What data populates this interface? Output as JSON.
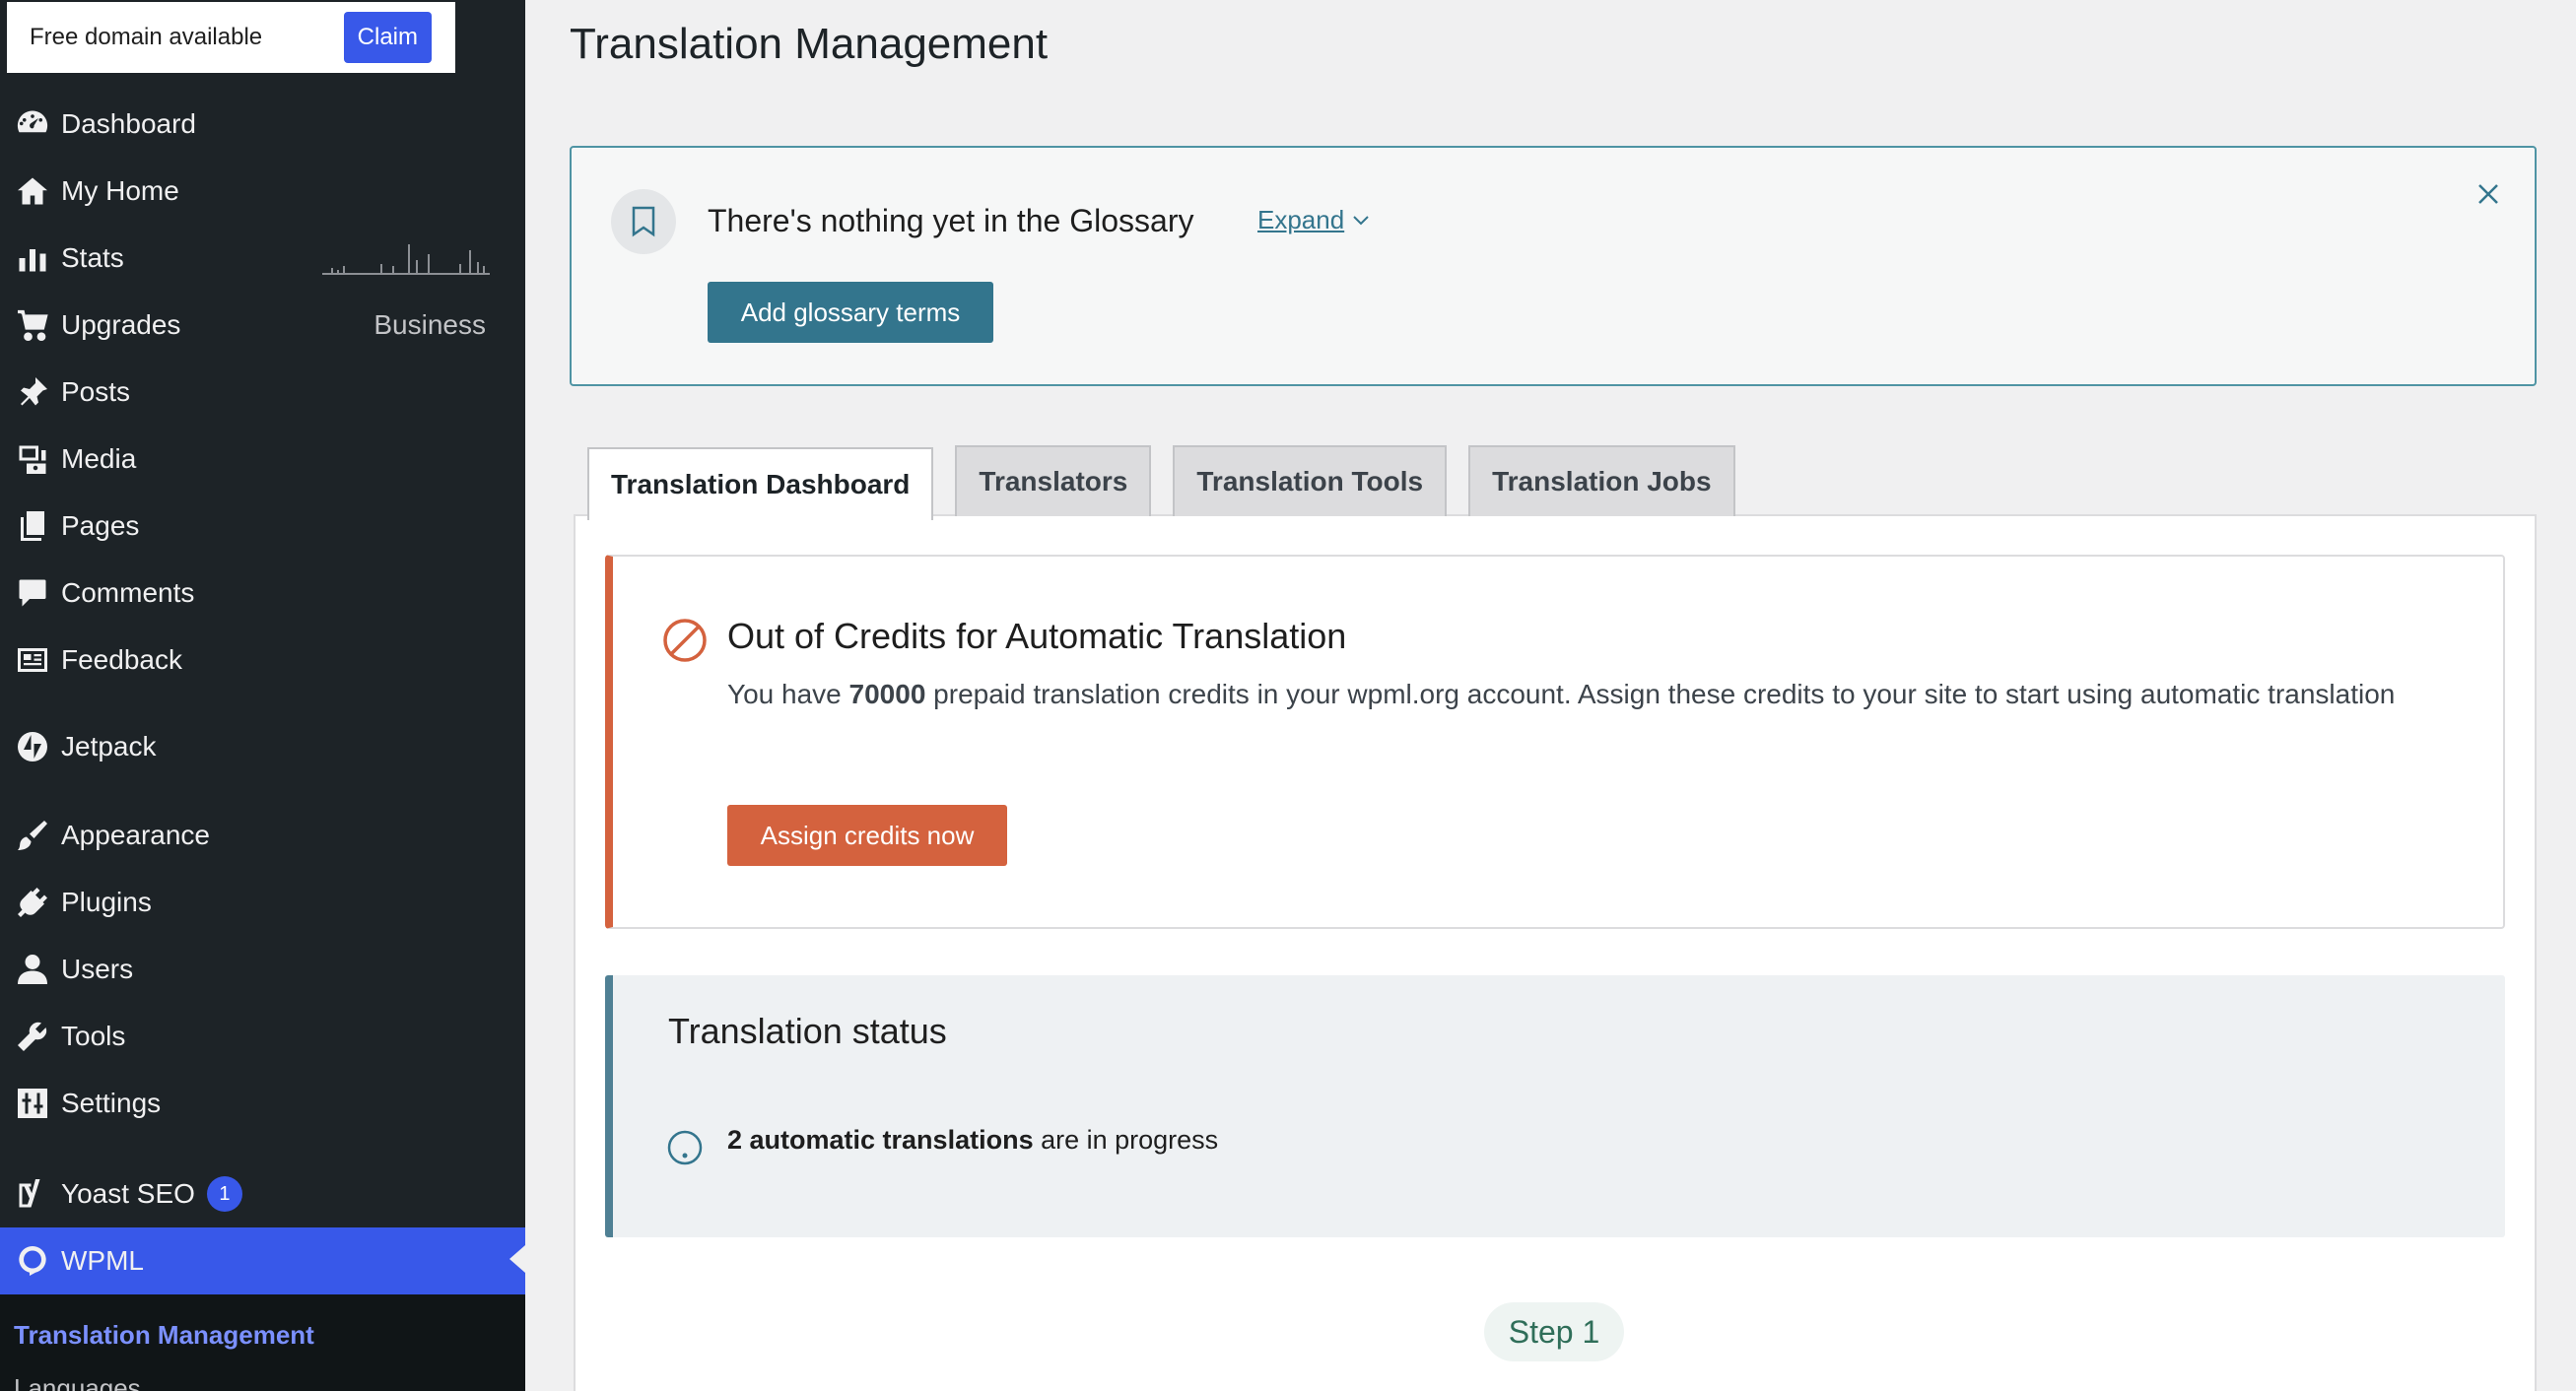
{
  "banner": {
    "text": "Free domain available",
    "claim_label": "Claim"
  },
  "sidebar": {
    "items": [
      {
        "label": "Dashboard",
        "icon": "dashboard-icon"
      },
      {
        "label": "My Home",
        "icon": "home-icon"
      },
      {
        "label": "Stats",
        "icon": "stats-icon"
      },
      {
        "label": "Upgrades",
        "icon": "cart-icon",
        "right": "Business"
      },
      {
        "label": "Posts",
        "icon": "pin-icon"
      },
      {
        "label": "Media",
        "icon": "media-icon"
      },
      {
        "label": "Pages",
        "icon": "pages-icon"
      },
      {
        "label": "Comments",
        "icon": "comment-icon"
      },
      {
        "label": "Feedback",
        "icon": "feedback-icon"
      },
      {
        "label": "Jetpack",
        "icon": "jetpack-icon"
      },
      {
        "label": "Appearance",
        "icon": "brush-icon"
      },
      {
        "label": "Plugins",
        "icon": "plug-icon"
      },
      {
        "label": "Users",
        "icon": "user-icon"
      },
      {
        "label": "Tools",
        "icon": "wrench-icon"
      },
      {
        "label": "Settings",
        "icon": "settings-icon"
      },
      {
        "label": "Yoast SEO",
        "icon": "yoast-icon",
        "badge": "1"
      },
      {
        "label": "WPML",
        "icon": "wpml-icon"
      }
    ],
    "submenu": {
      "current": "Translation Management",
      "next": "Languages"
    }
  },
  "page": {
    "title": "Translation Management"
  },
  "glossary": {
    "text": "There's nothing yet in the Glossary",
    "expand_label": "Expand",
    "add_label": "Add glossary terms"
  },
  "tabs": [
    {
      "label": "Translation Dashboard",
      "active": true
    },
    {
      "label": "Translators"
    },
    {
      "label": "Translation Tools"
    },
    {
      "label": "Translation Jobs"
    }
  ],
  "credits": {
    "title": "Out of Credits for Automatic Translation",
    "text_before": "You have ",
    "amount": "70000",
    "text_after": " prepaid translation credits in your wpml.org account. Assign these credits to your site to start using automatic translation",
    "button_label": "Assign credits now"
  },
  "status": {
    "title": "Translation status",
    "count_text": "2 automatic translations",
    "rest_text": " are in progress"
  },
  "step": {
    "label": "Step 1"
  },
  "colors": {
    "accent": "#3858e9",
    "warning": "#d4623e",
    "teal": "#33758d"
  }
}
